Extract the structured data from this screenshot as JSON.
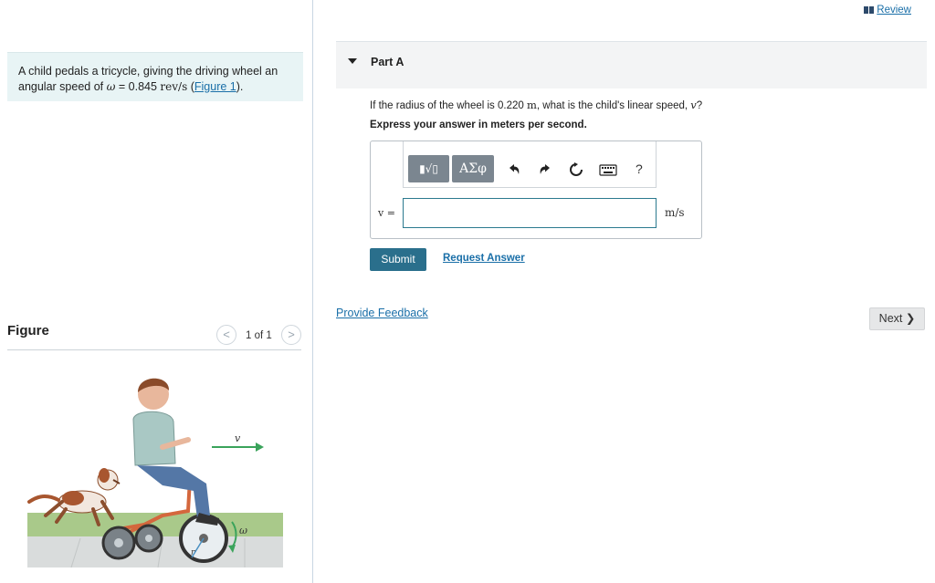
{
  "problem": {
    "line1": "A child pedals a tricycle, giving the driving wheel an",
    "line2_prefix": "angular speed of ",
    "omega_symbol": "ω",
    "equals": " = 0.845 ",
    "unit": "rev/s",
    "paren_open": " (",
    "figure_link": "Figure 1",
    "paren_close": ")."
  },
  "figure": {
    "title": "Figure",
    "pager": "1 of 1",
    "prev_glyph": "<",
    "next_glyph": ">",
    "v_label": "v",
    "omega_label": "ω",
    "r_label": "r"
  },
  "header": {
    "review_label": "Review"
  },
  "part": {
    "label": "Part A",
    "question_prefix": "If the radius of the wheel is 0.220 ",
    "question_unit": "m",
    "question_suffix": ", what is the child's linear speed, ",
    "question_var": "v",
    "question_end": "?",
    "instruction": "Express your answer in meters per second.",
    "toolbar": {
      "templates_label": "▮√▯",
      "greek_label": "ΑΣφ",
      "help_label": "?"
    },
    "answer_var_label": "v =",
    "answer_value": "",
    "unit_label": "m/s",
    "submit_label": "Submit",
    "request_label": "Request Answer"
  },
  "footer": {
    "feedback_label": "Provide Feedback",
    "next_label": "Next ❯"
  }
}
